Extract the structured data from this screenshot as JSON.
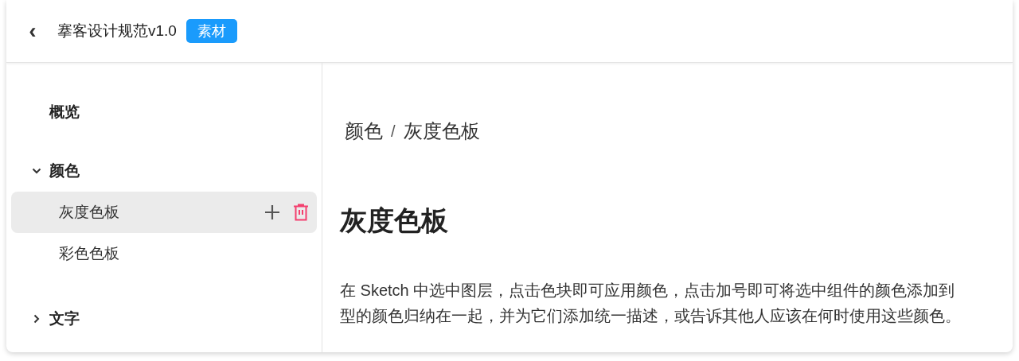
{
  "header": {
    "back_icon": "‹",
    "title": "搴客设计规范v1.0",
    "badge": "素材"
  },
  "sidebar": {
    "items": [
      {
        "label": "概览",
        "selected": false
      },
      {
        "label": "颜色",
        "selected": false,
        "expanded": true,
        "children": [
          {
            "label": "灰度色板",
            "selected": true
          },
          {
            "label": "彩色色板",
            "selected": false
          }
        ]
      },
      {
        "label": "文字",
        "selected": false,
        "expanded": false
      }
    ]
  },
  "breadcrumb": [
    "颜色",
    "灰度色板"
  ],
  "breadcrumb_separator": "/",
  "heading": "灰度色板",
  "description": [
    "在 Sketch 中选中图层，点击色块即可应用颜色，点击加号即可将选中组件的颜色添加到",
    "型的颜色归纳在一起，并为它们添加统一描述，或告诉其他人应该在何时使用这些颜色。"
  ]
}
